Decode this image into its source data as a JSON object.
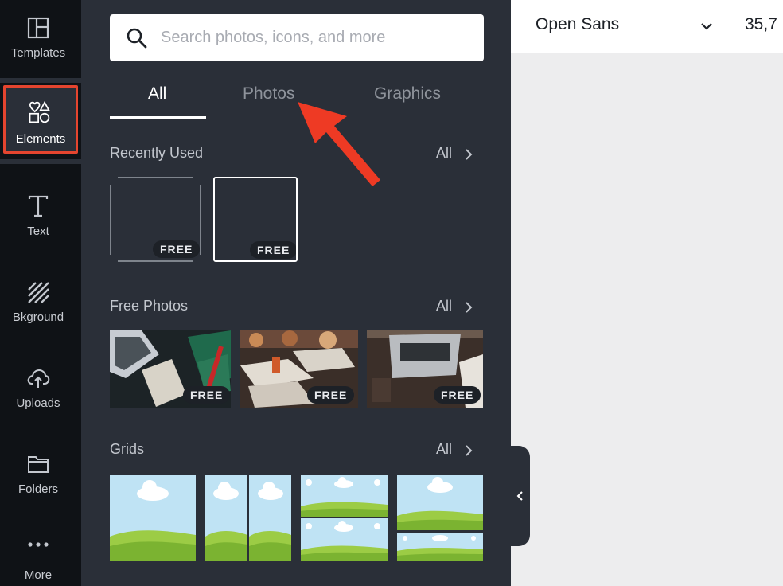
{
  "rail": {
    "items": [
      {
        "label": "Templates",
        "icon": "template-icon"
      },
      {
        "label": "Elements",
        "icon": "elements-icon"
      },
      {
        "label": "Text",
        "icon": "text-icon"
      },
      {
        "label": "Bkground",
        "icon": "background-icon"
      },
      {
        "label": "Uploads",
        "icon": "upload-icon"
      },
      {
        "label": "Folders",
        "icon": "folder-icon"
      },
      {
        "label": "More",
        "icon": "more-icon"
      }
    ]
  },
  "search": {
    "placeholder": "Search photos, icons, and more",
    "value": ""
  },
  "tabs": [
    {
      "label": "All",
      "active": true
    },
    {
      "label": "Photos",
      "active": false
    },
    {
      "label": "Graphics",
      "active": false
    }
  ],
  "sections": {
    "recent": {
      "title": "Recently Used",
      "all": "All"
    },
    "free_photos": {
      "title": "Free Photos",
      "all": "All"
    },
    "grids": {
      "title": "Grids",
      "all": "All"
    }
  },
  "badge": {
    "free": "FREE"
  },
  "toolbar": {
    "font": "Open Sans",
    "size": "35,7"
  },
  "colors": {
    "accent": "#e5452f",
    "panel": "#2a2f38",
    "rail": "#0f1216"
  }
}
